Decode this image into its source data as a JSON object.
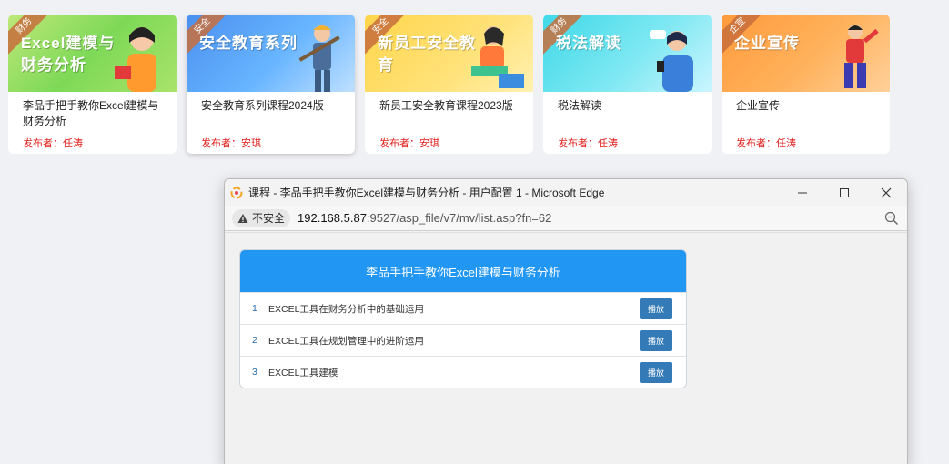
{
  "cards": [
    {
      "tag": "财务",
      "banner": "Excel建模与财务分析",
      "title": "李品手把手教你Excel建模与财务分析",
      "publisher": "发布者：任涛"
    },
    {
      "tag": "安全",
      "banner": "安全教育系列",
      "title": "安全教育系列课程2024版",
      "publisher": "发布者：安琪"
    },
    {
      "tag": "安全",
      "banner": "新员工安全教育",
      "title": "新员工安全教育课程2023版",
      "publisher": "发布者：安琪"
    },
    {
      "tag": "财务",
      "banner": "税法解读",
      "title": "税法解读",
      "publisher": "发布者：任涛"
    },
    {
      "tag": "企宣",
      "banner": "企业宣传",
      "title": "企业宣传",
      "publisher": "发布者：任涛"
    }
  ],
  "window": {
    "title": "课程 - 李品手把手教你Excel建模与财务分析 - 用户配置 1 - Microsoft Edge",
    "security_label": "不安全",
    "url_host": "192.168.5.87",
    "url_rest": ":9527/asp_file/v7/mv/list.asp?fn=62"
  },
  "panel": {
    "title": "李品手把手教你Excel建模与财务分析",
    "items": [
      {
        "num": "1",
        "name": "EXCEL工具在财务分析中的基础运用",
        "button": "播放"
      },
      {
        "num": "2",
        "name": "EXCEL工具在规划管理中的进阶运用",
        "button": "播放"
      },
      {
        "num": "3",
        "name": "EXCEL工具建模",
        "button": "播放"
      }
    ]
  },
  "icons": [
    "edge-logo-icon",
    "minimize-icon",
    "maximize-icon",
    "close-icon",
    "warning-icon",
    "zoom-out-icon"
  ]
}
